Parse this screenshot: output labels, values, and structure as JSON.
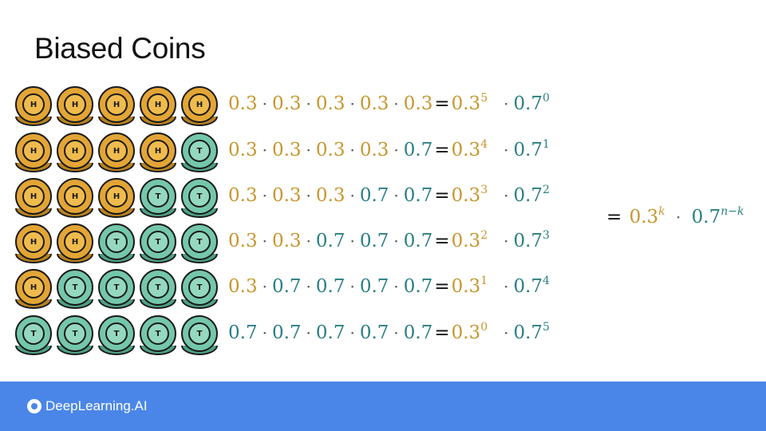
{
  "title": "Biased Coins",
  "colors": {
    "heads": "#e3a535",
    "tails": "#74c7ab",
    "p_heads_text": "#c8962e",
    "p_tails_text": "#2a7f82",
    "footer": "#4a86e8"
  },
  "p_heads": "0.3",
  "p_tails": "0.7",
  "rows": [
    {
      "coins": [
        "H",
        "H",
        "H",
        "H",
        "H"
      ],
      "terms": [
        "0.3",
        "0.3",
        "0.3",
        "0.3",
        "0.3"
      ],
      "heads_exp": "5",
      "tails_exp": "0"
    },
    {
      "coins": [
        "H",
        "H",
        "H",
        "H",
        "T"
      ],
      "terms": [
        "0.3",
        "0.3",
        "0.3",
        "0.3",
        "0.7"
      ],
      "heads_exp": "4",
      "tails_exp": "1"
    },
    {
      "coins": [
        "H",
        "H",
        "H",
        "T",
        "T"
      ],
      "terms": [
        "0.3",
        "0.3",
        "0.3",
        "0.7",
        "0.7"
      ],
      "heads_exp": "3",
      "tails_exp": "2"
    },
    {
      "coins": [
        "H",
        "H",
        "T",
        "T",
        "T"
      ],
      "terms": [
        "0.3",
        "0.3",
        "0.7",
        "0.7",
        "0.7"
      ],
      "heads_exp": "2",
      "tails_exp": "3"
    },
    {
      "coins": [
        "H",
        "T",
        "T",
        "T",
        "T"
      ],
      "terms": [
        "0.3",
        "0.7",
        "0.7",
        "0.7",
        "0.7"
      ],
      "heads_exp": "1",
      "tails_exp": "4"
    },
    {
      "coins": [
        "T",
        "T",
        "T",
        "T",
        "T"
      ],
      "terms": [
        "0.7",
        "0.7",
        "0.7",
        "0.7",
        "0.7"
      ],
      "heads_exp": "0",
      "tails_exp": "5"
    }
  ],
  "summary": {
    "equals": "=",
    "base_heads": "0.3",
    "exp_heads": "k",
    "dot": "·",
    "base_tails": "0.7",
    "exp_tails": "n−k"
  },
  "footer": {
    "brand": "DeepLearning.AI"
  }
}
